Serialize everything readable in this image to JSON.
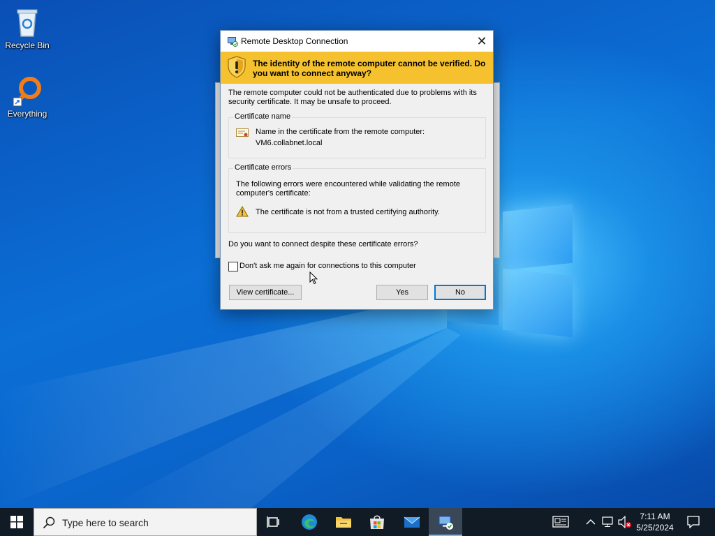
{
  "desktop": {
    "icons": [
      {
        "label": "Recycle Bin",
        "icon": "recycle-bin-icon"
      },
      {
        "label": "Everything",
        "icon": "everything-search-icon"
      }
    ]
  },
  "dialog": {
    "title": "Remote Desktop Connection",
    "close_glyph": "✕",
    "banner": "The identity of the remote computer cannot be verified. Do you want to connect anyway?",
    "intro": "The remote computer could not be authenticated due to problems with its security certificate. It may be unsafe to proceed.",
    "cert_name": {
      "group_title": "Certificate name",
      "label": "Name in the certificate from the remote computer:",
      "value": "VM6.collabnet.local"
    },
    "cert_errors": {
      "group_title": "Certificate errors",
      "description": "The following errors were encountered while validating the remote computer's certificate:",
      "error": "The certificate is not from a trusted certifying authority."
    },
    "question": "Do you want to connect despite these certificate errors?",
    "dont_ask": {
      "label": "Don't ask me again for connections to this computer",
      "checked": false
    },
    "buttons": {
      "view_certificate": "View certificate...",
      "yes": "Yes",
      "no": "No"
    },
    "colors": {
      "banner": "#f5c12e",
      "default_button_border": "#0078d7"
    }
  },
  "taskbar": {
    "search_placeholder": "Type here to search",
    "apps": [
      "task-view-icon",
      "edge-icon",
      "file-explorer-icon",
      "microsoft-store-icon",
      "mail-icon",
      "remote-desktop-icon"
    ],
    "tray": {
      "time": "7:11 AM",
      "date": "5/25/2024"
    },
    "colors": {
      "taskbar_bg": "#101b26",
      "active_app_underline": "#76b9ed"
    }
  }
}
